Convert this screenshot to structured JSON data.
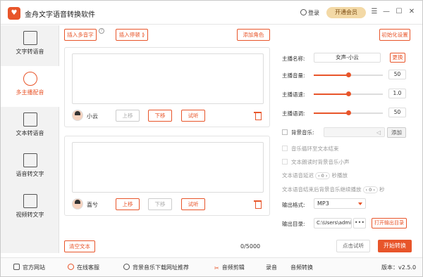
{
  "app": {
    "title": "金舟文字语音转换软件",
    "logo_char": "♥"
  },
  "header": {
    "login": "登录",
    "vip": "开通会员"
  },
  "sidebar": {
    "items": [
      {
        "label": "文字转语音"
      },
      {
        "label": "多主播配音"
      },
      {
        "label": "文本转语音"
      },
      {
        "label": "语音转文字"
      },
      {
        "label": "视频转文字"
      }
    ]
  },
  "toolbar": {
    "insert_polyphone": "插入多音字",
    "insert_pause": "插入停顿 ⟫",
    "add_role": "添加角色",
    "reset": "初始化设置"
  },
  "cards": [
    {
      "name": "小云",
      "up": "上移",
      "down": "下移",
      "listen": "试听",
      "text": ""
    },
    {
      "name": "喜兮",
      "up": "上移",
      "down": "下移",
      "listen": "试听",
      "text": ""
    }
  ],
  "footer_left": {
    "clear": "清空文本",
    "count": "0/5000"
  },
  "settings": {
    "anchor_label": "主播名称:",
    "anchor_value": "女声-小云",
    "change": "更换",
    "volume_label": "主播音量:",
    "volume": "50",
    "volume_level": 0.5,
    "speed_label": "主播语速:",
    "speed": "1.0",
    "speed_level": 0.5,
    "pitch_label": "主播语调:",
    "pitch": "50",
    "pitch_level": 0.5,
    "bgm_label": "背景音乐:",
    "bgm_add": "添加",
    "loop": "音乐循环至文本结束",
    "duck": "文本朗读时背景音乐小声",
    "delay_prefix": "文本语音延迟",
    "delay_value": "0",
    "delay_suffix": "秒播放",
    "continue_prefix": "文本语音结束后背景音乐继续播放",
    "continue_value": "0",
    "continue_suffix": "秒",
    "format_label": "输出格式:",
    "format_value": "MP3",
    "dir_label": "输出目录:",
    "dir_value": "C:\\Users\\admir",
    "dir_more": "•••",
    "open_dir": "打开输出目录",
    "preview": "点击试听",
    "start": "开始转换"
  },
  "bottombar": {
    "website": "官方网站",
    "service": "在线客服",
    "bgm_rec": "背景音乐下载网址推荐",
    "audio_cut": "音频剪辑",
    "record": "录音",
    "audio_convert": "音频转换",
    "version": "版本：v2.5.0"
  },
  "colors": {
    "accent": "#e8552a",
    "vip_bg": "#f3d9a6"
  }
}
